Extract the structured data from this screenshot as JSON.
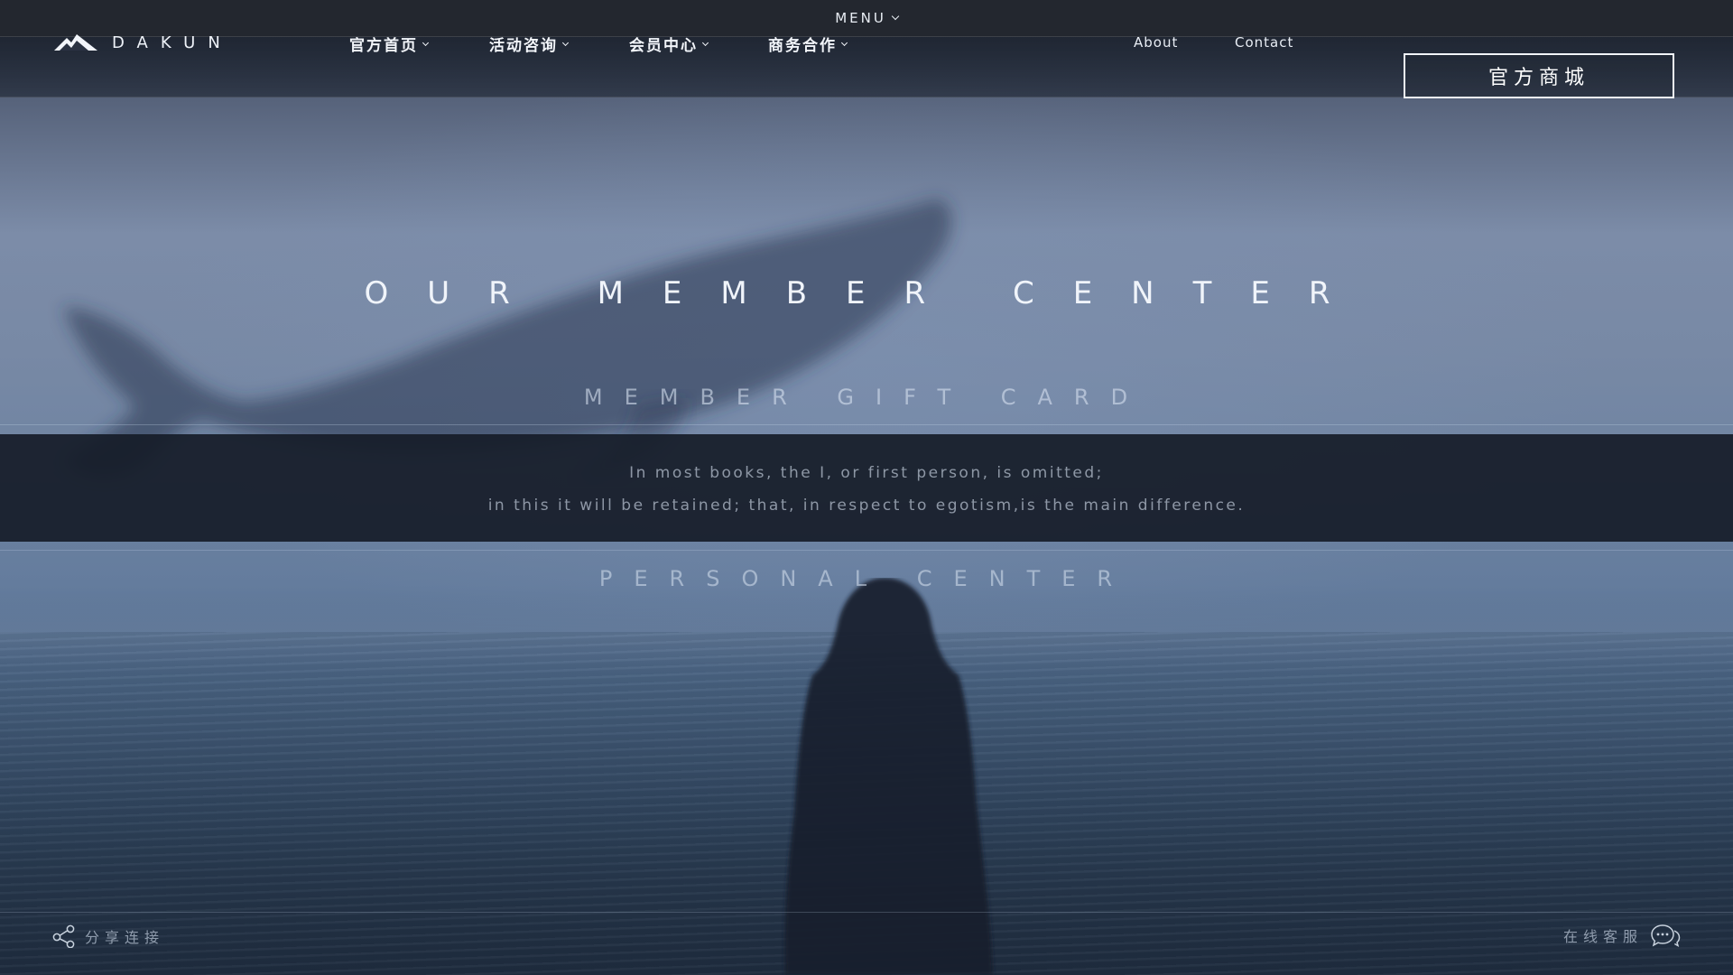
{
  "topbar": {
    "menu_label": "MENU"
  },
  "header": {
    "logo_text": "DAKUN",
    "nav": [
      {
        "label": "官方首页"
      },
      {
        "label": "活动咨询"
      },
      {
        "label": "会员中心"
      },
      {
        "label": "商务合作"
      }
    ],
    "links": {
      "about": "About",
      "contact": "Contact"
    },
    "shop_button": "官方商城"
  },
  "hero": {
    "title": "OUR MEMBER CENTER",
    "gift_card": "MEMBER GIFT CARD",
    "quote": [
      "In most books, the I, or first person, is omitted;",
      "in this it will be retained; that, in respect to egotism,is the main difference."
    ],
    "personal_center": "PERSONAL CENTER"
  },
  "footer": {
    "share_label": "分享连接",
    "service_label": "在线客服"
  },
  "icons": {
    "logo": "mountain-icon",
    "share": "share-icon",
    "service": "chat-bubble-icon",
    "dropdown": "chevron-down-icon"
  },
  "colors": {
    "top_bar": "#23272f",
    "quote_band": "#161c28",
    "text_primary": "#f0f4fa"
  }
}
